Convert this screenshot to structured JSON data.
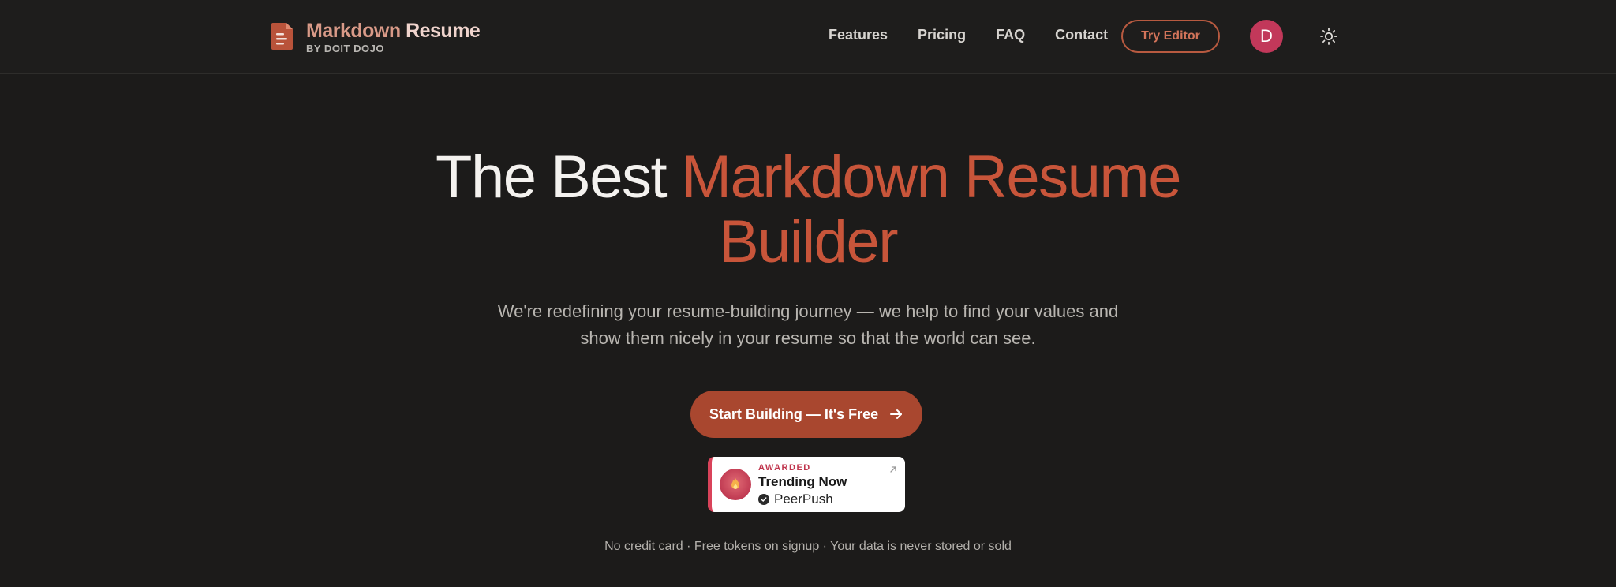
{
  "brand": {
    "title_accent": "Markdown",
    "title_rest": " Resume",
    "subtitle": "BY DOIT DOJO",
    "icon": "document-icon"
  },
  "nav": {
    "links": [
      "Features",
      "Pricing",
      "FAQ",
      "Contact"
    ],
    "try_editor": "Try Editor",
    "avatar_initial": "D",
    "theme_icon": "sun-icon"
  },
  "hero": {
    "title_plain": "The Best ",
    "title_accent_line1": "Markdown Resume",
    "title_accent_line2": "Builder",
    "subtitle_line1": "We're redefining your resume-building journey — we help to find your values and",
    "subtitle_line2": "show them nicely in your resume so that the world can see.",
    "cta_label": "Start Building — It's Free",
    "cta_icon": "arrow-right-icon"
  },
  "badge": {
    "label": "AWARDED",
    "title": "Trending Now",
    "brand": "PeerPush",
    "icon": "medal-icon"
  },
  "fineprint": "No credit card · Free tokens on signup · Your data is never stored or sold",
  "colors": {
    "background": "#1c1b1a",
    "accent": "#c8553a",
    "cta": "#a9472f",
    "avatar": "#c2385a"
  }
}
